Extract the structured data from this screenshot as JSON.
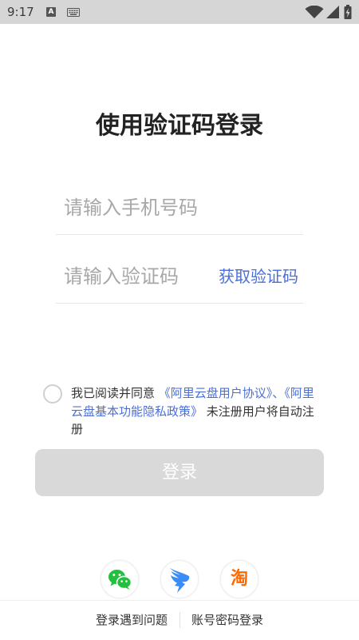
{
  "status_bar": {
    "time": "9:17",
    "input_method_badge": "A"
  },
  "login": {
    "title": "使用验证码登录",
    "phone_placeholder": "请输入手机号码",
    "code_placeholder": "请输入验证码",
    "get_code_label": "获取验证码",
    "agreement": {
      "checked": false,
      "prefix": "我已阅读并同意 ",
      "link_user": "《阿里云盘用户协议》",
      "separator": "、",
      "link_privacy": "《阿里云盘基本功能隐私政策》",
      "suffix": " 未注册用户将自动注册"
    },
    "submit_label": "登录"
  },
  "third_party": {
    "icons": [
      "wechat-icon",
      "dingtalk-icon",
      "taobao-icon"
    ],
    "taobao_glyph": "淘"
  },
  "footer": {
    "help_label": "登录遇到问题",
    "password_login_label": "账号密码登录"
  },
  "colors": {
    "accent": "#4b6fd8",
    "button_disabled": "#d9d9d9",
    "wechat_green": "#22c13d",
    "dingtalk_blue": "#3a8df7",
    "taobao_orange": "#ff6a00"
  }
}
